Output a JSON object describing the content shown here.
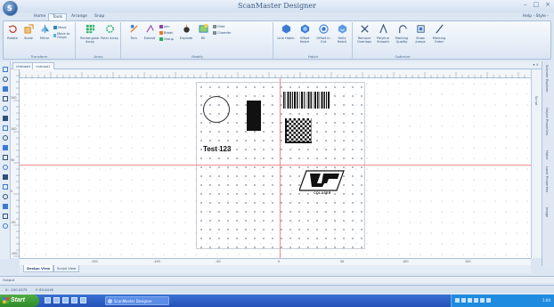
{
  "window": {
    "title": "ScanMaster Designer",
    "app_button_letter": "S",
    "controls": [
      "–",
      "□",
      "×"
    ]
  },
  "tabs": [
    {
      "label": "Home",
      "active": false
    },
    {
      "label": "Tools",
      "active": true
    },
    {
      "label": "Arrange",
      "active": false
    },
    {
      "label": "Snap",
      "active": false
    }
  ],
  "help_menu": "Help - Style -",
  "ribbon": {
    "groups": [
      {
        "label": "Transform",
        "buttons": [
          {
            "label": "Rotate",
            "icon": "rotate-icon",
            "color": "#c0392b"
          },
          {
            "label": "Scale",
            "icon": "scale-icon",
            "color": "#d88c1a"
          },
          {
            "label": "Mirror",
            "icon": "mirror-icon",
            "color": "#2e86c1"
          }
        ],
        "small": [
          "Move",
          "Move to Origin"
        ]
      },
      {
        "label": "Array",
        "buttons": [
          {
            "label": "Rectangular Array",
            "icon": "rect-array-icon",
            "color": "#27ae60"
          },
          {
            "label": "Polar Array",
            "icon": "polar-array-icon",
            "color": "#27ae60"
          }
        ]
      },
      {
        "label": "Modify",
        "buttons": [
          {
            "label": "Trim",
            "icon": "trim-icon",
            "color": "#e67e22"
          },
          {
            "label": "Extend",
            "icon": "extend-icon",
            "color": "#8e44ad"
          },
          {
            "label": "Explode",
            "icon": "explode-icon",
            "color": "#555555"
          },
          {
            "label": "Fill",
            "icon": "fill-icon",
            "color": "#2e86c1"
          }
        ],
        "small": [
          "Join",
          "Break",
          "Group",
          "Fillet",
          "Chamfer"
        ]
      },
      {
        "label": "Hatch",
        "buttons": [
          {
            "label": "Line Hatch",
            "icon": "line-hatch-icon",
            "color": "#3a7bd5"
          },
          {
            "label": "Offset Hatch",
            "icon": "offset-hatch-icon",
            "color": "#3a7bd5"
          },
          {
            "label": "Offset in Out",
            "icon": "offset-in-out-icon",
            "color": "#3a7bd5"
          },
          {
            "label": "Helix Hatch",
            "icon": "helix-hatch-icon",
            "color": "#3a7bd5"
          }
        ]
      },
      {
        "label": "Optimize",
        "buttons": [
          {
            "label": "Remove Overlaps",
            "icon": "remove-overlaps-icon",
            "color": "#2f4f78"
          },
          {
            "label": "Polyline Smooth",
            "icon": "polyline-smooth-icon",
            "color": "#2f4f78"
          },
          {
            "label": "Marking Quality",
            "icon": "marking-quality-icon",
            "color": "#2f4f78"
          },
          {
            "label": "Show Jumps",
            "icon": "show-jumps-icon",
            "color": "#2f4f78"
          },
          {
            "label": "Marking Order",
            "icon": "marking-order-icon",
            "color": "#2f4f78"
          }
        ]
      }
    ]
  },
  "doc_tabs": [
    {
      "label": "Untitled1",
      "active": false
    },
    {
      "label": "Untitled2",
      "active": true
    }
  ],
  "left_tools": [
    "select-icon",
    "line-icon",
    "polyline-icon",
    "rectangle-icon",
    "circle-icon",
    "arc-icon",
    "ellipse-icon",
    "spiral-icon",
    "text-icon",
    "barcode-icon",
    "image-icon",
    "point-icon",
    "node-edit-icon",
    "pan-icon",
    "zoom-icon",
    "measure-icon",
    "layer-icon"
  ],
  "right_panel_tabs": [
    "Scanner Explorer",
    "Object Properties",
    "Hatch",
    "Laser Properties",
    "Image"
  ],
  "script_panel_label": "Script",
  "canvas": {
    "text_object": "Test 123",
    "logo_text": "COLASER",
    "axis_color": "#ef8c8c"
  },
  "ruler_labels_top": [
    "-150",
    "-100",
    "-50",
    "0",
    "50",
    "100",
    "150"
  ],
  "ruler_labels_left": [
    "150",
    "100",
    "50",
    "0",
    "-50",
    "-100"
  ],
  "view_tabs": [
    {
      "label": "Design View",
      "active": true
    },
    {
      "label": "Script View",
      "active": false
    }
  ],
  "output_label": "Output",
  "status": {
    "x_coord": "X: -100.0275",
    "y_coord": "Y: 83.0416"
  },
  "taskbar": {
    "start_label": "Start",
    "app_label": "ScanMaster Designer",
    "clock": "1:04"
  }
}
